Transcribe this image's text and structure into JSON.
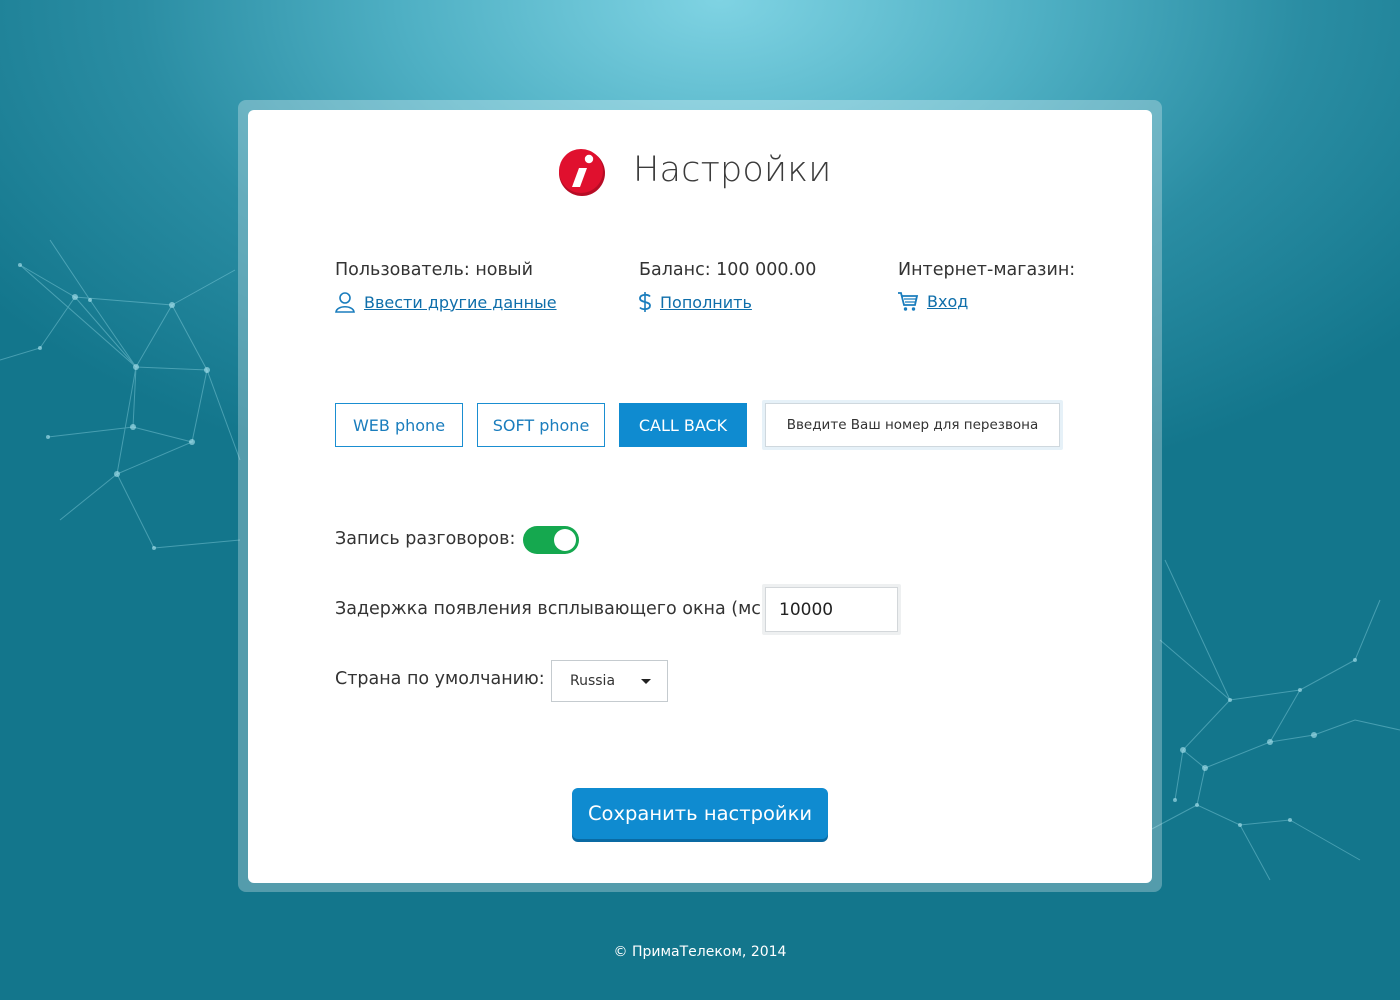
{
  "page": {
    "title": "Настройки"
  },
  "info": {
    "user_label": "Пользователь: новый",
    "user_link": "Ввести другие данные",
    "balance_label": "Баланс: 100 000.00",
    "balance_link": "Пополнить",
    "shop_label": "Интернет-магазин:",
    "shop_link": "Вход"
  },
  "modes": {
    "web_phone": "WEB phone",
    "soft_phone": "SOFT phone",
    "call_back": "CALL BACK",
    "active": "call_back",
    "phone_placeholder": "Введите Ваш номер для перезвона"
  },
  "settings": {
    "recording_label": "Запись разговоров:",
    "recording_on": true,
    "delay_label": "Задержка появления всплывающего окна (мс):",
    "delay_value": "10000",
    "country_label": "Страна по умолчанию:",
    "country_value": "Russia"
  },
  "actions": {
    "save_label": "Сохранить настройки"
  },
  "footer": {
    "copyright": "© ПримаТелеком, 2014"
  },
  "colors": {
    "accent": "#0f8bd0",
    "toggle_on": "#15a84f",
    "logo_red": "#e0102e"
  },
  "icons": {
    "user": "user-icon",
    "balance": "dollar-icon",
    "shop": "cart-icon",
    "logo": "info-logo-icon"
  }
}
